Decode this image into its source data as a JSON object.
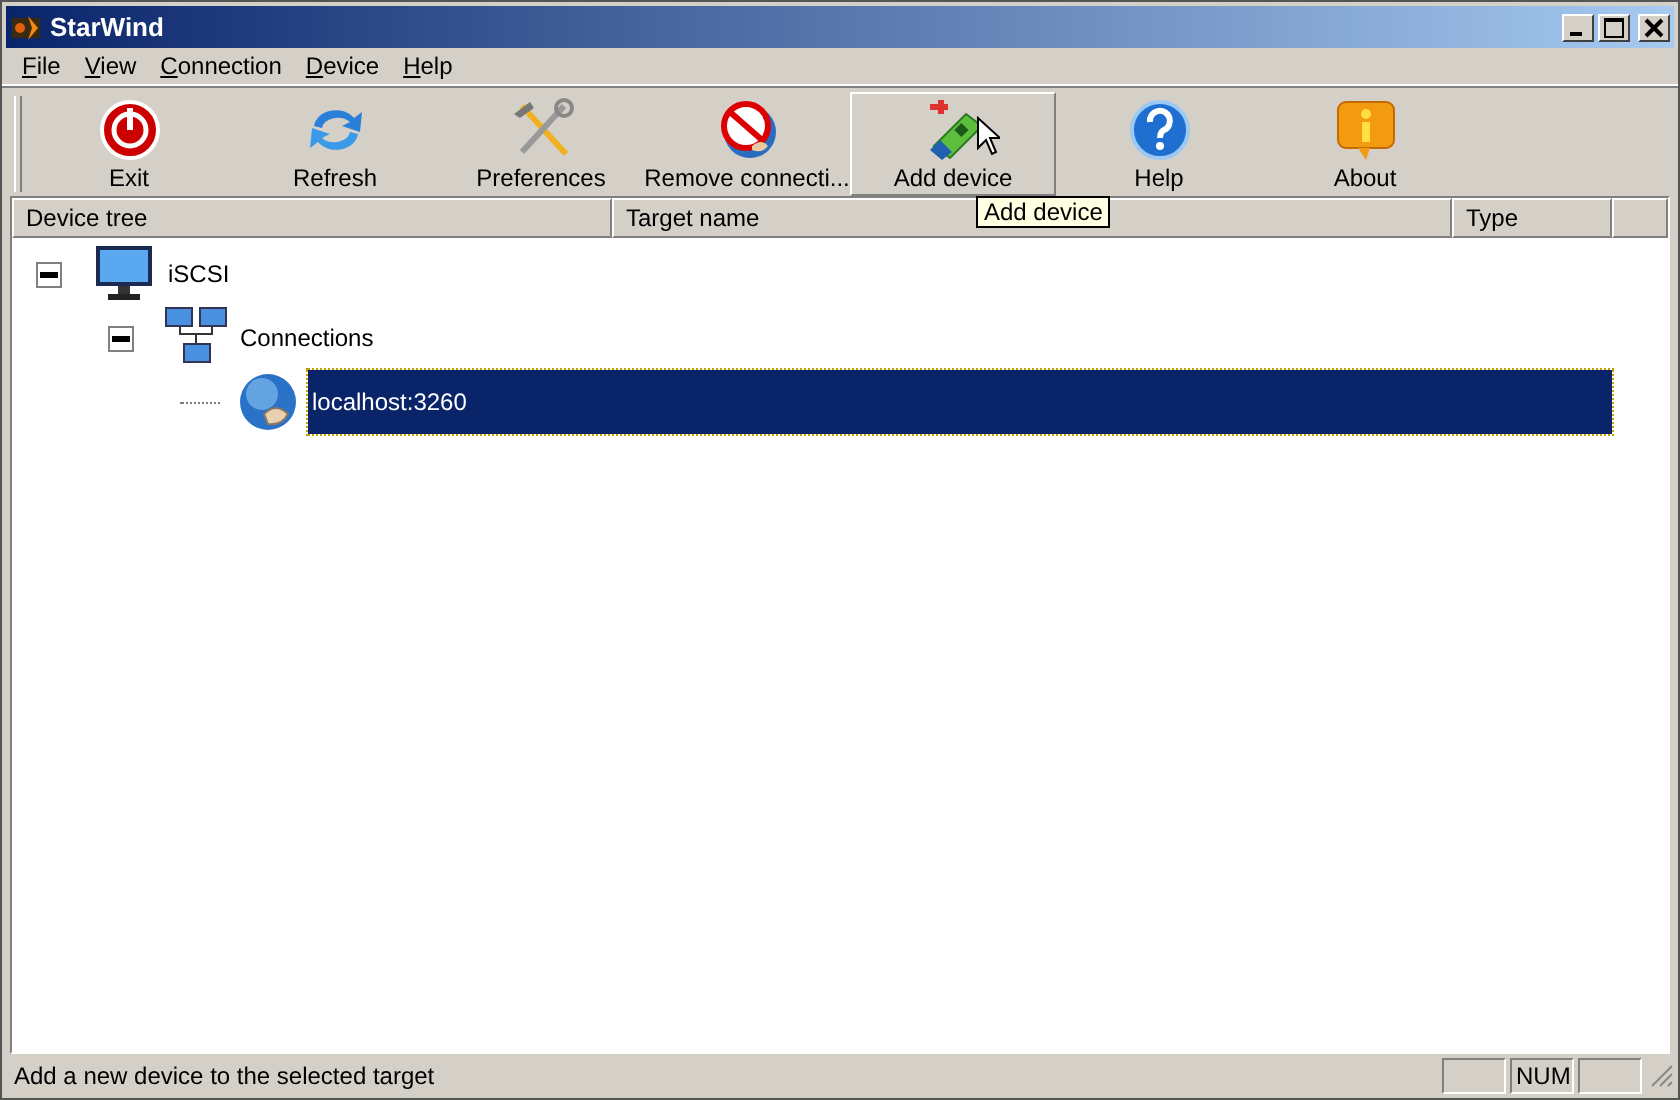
{
  "window": {
    "title": "StarWind"
  },
  "menu": [
    {
      "label": "File"
    },
    {
      "label": "View"
    },
    {
      "label": "Connection"
    },
    {
      "label": "Device"
    },
    {
      "label": "Help"
    }
  ],
  "toolbar": [
    {
      "label": "Exit",
      "kind": "exit",
      "hovered": false
    },
    {
      "label": "Refresh",
      "kind": "refresh",
      "hovered": false
    },
    {
      "label": "Preferences",
      "kind": "tools",
      "hovered": false
    },
    {
      "label": "Remove connecti...",
      "kind": "remove",
      "hovered": false
    },
    {
      "label": "Add device",
      "kind": "add",
      "hovered": true
    },
    {
      "label": "Help",
      "kind": "help",
      "hovered": false
    },
    {
      "label": "About",
      "kind": "about",
      "hovered": false
    }
  ],
  "tooltip": "Add device",
  "columns": [
    {
      "label": "Device tree"
    },
    {
      "label": "Target name"
    },
    {
      "label": "Type"
    }
  ],
  "tree": [
    {
      "label": "iSCSI",
      "kind": "computer",
      "expanded": true,
      "selected": false,
      "children": [
        {
          "label": "Connections",
          "kind": "network",
          "expanded": true,
          "selected": false,
          "children": [
            {
              "label": "localhost:3260",
              "kind": "globe",
              "selected": true
            }
          ]
        }
      ]
    }
  ],
  "status_bar": {
    "text": "Add a new device to the selected target",
    "indicators": [
      "NUM"
    ]
  }
}
